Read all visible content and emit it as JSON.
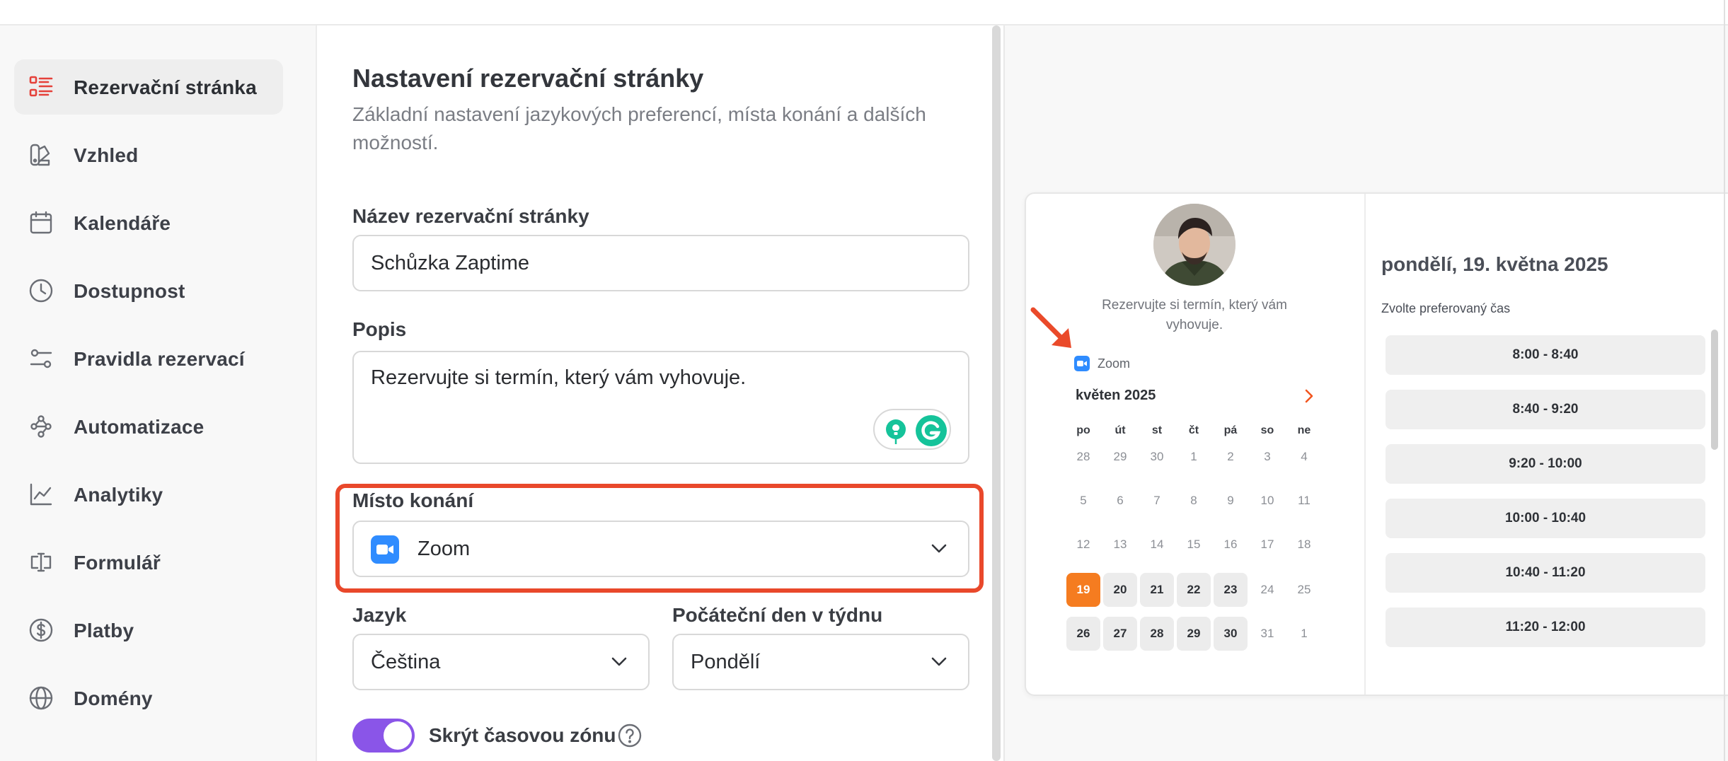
{
  "sidebar": {
    "items": [
      {
        "label": "Rezervační stránka",
        "icon": "booking-page-icon",
        "active": true
      },
      {
        "label": "Vzhled",
        "icon": "appearance-icon"
      },
      {
        "label": "Kalendáře",
        "icon": "calendar-icon"
      },
      {
        "label": "Dostupnost",
        "icon": "clock-icon"
      },
      {
        "label": "Pravidla rezervací",
        "icon": "rules-icon"
      },
      {
        "label": "Automatizace",
        "icon": "automation-icon"
      },
      {
        "label": "Analytiky",
        "icon": "analytics-icon"
      },
      {
        "label": "Formulář",
        "icon": "form-icon"
      },
      {
        "label": "Platby",
        "icon": "dollar-icon"
      },
      {
        "label": "Domény",
        "icon": "globe-icon"
      }
    ]
  },
  "form": {
    "title": "Nastavení rezervační stránky",
    "subtitle": "Základní nastavení jazykových preferencí, místa konání a dalších možností.",
    "name_label": "Název rezervační stránky",
    "name_value": "Schůzka Zaptime",
    "description_label": "Popis",
    "description_value": "Rezervujte si termín, který vám vyhovuje.",
    "location_label": "Místo konání",
    "location_value": "Zoom",
    "language_label": "Jazyk",
    "language_value": "Čeština",
    "start_day_label": "Počáteční den v týdnu",
    "start_day_value": "Pondělí",
    "hide_timezone_label": "Skrýt časovou zónu",
    "hide_timezone_on": true
  },
  "preview": {
    "description": "Rezervujte si termín, který vám vyhovuje.",
    "location": "Zoom",
    "month": "květen 2025",
    "weekdays": [
      "po",
      "út",
      "st",
      "čt",
      "pá",
      "so",
      "ne"
    ],
    "weeks": [
      [
        "28",
        "29",
        "30",
        "1",
        "2",
        "3",
        "4"
      ],
      [
        "5",
        "6",
        "7",
        "8",
        "9",
        "10",
        "11"
      ],
      [
        "12",
        "13",
        "14",
        "15",
        "16",
        "17",
        "18"
      ],
      [
        "19",
        "20",
        "21",
        "22",
        "23",
        "24",
        "25"
      ],
      [
        "26",
        "27",
        "28",
        "29",
        "30",
        "31",
        "1"
      ]
    ],
    "selected_day": "19",
    "available_days": [
      "20",
      "21",
      "22",
      "23",
      "26",
      "27",
      "28",
      "29",
      "30"
    ],
    "selected_date": "pondělí, 19. května 2025",
    "choose_time": "Zvolte preferovaný čas",
    "slots": [
      "8:00 - 8:40",
      "8:40 - 9:20",
      "9:20 - 10:00",
      "10:00 - 10:40",
      "10:40 - 11:20",
      "11:20 - 12:00"
    ]
  },
  "colors": {
    "accent_red": "#e9482b",
    "selected_day": "#f57c20",
    "toggle_purple": "#8a55e8",
    "zoom_blue": "#2f8cff"
  }
}
